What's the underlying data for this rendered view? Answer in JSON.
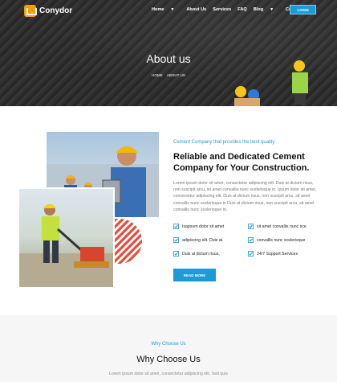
{
  "header": {
    "brand": "Conydor",
    "nav": [
      {
        "label": "Home",
        "has_dropdown": true
      },
      {
        "label": "About Us",
        "has_dropdown": false
      },
      {
        "label": "Services",
        "has_dropdown": false
      },
      {
        "label": "FAQ",
        "has_dropdown": false
      },
      {
        "label": "Blog",
        "has_dropdown": true
      },
      {
        "label": "Contact",
        "has_dropdown": false
      }
    ],
    "login_label": "LOGIN"
  },
  "hero": {
    "title": "About us",
    "breadcrumb": [
      "HOME",
      "ABOUT US"
    ]
  },
  "about": {
    "subtitle": "Cement Company that provides the best quality",
    "heading": "Reliable and Dedicated Cement Company for Your Construction.",
    "paragraph": "Lorem ipsum dolor sit amet, consectetur adipiscing elit. Duis at dictum risus, non suscipit arcu, sit amet convallis nunc scelerisque in. Ipsum dolor sit amet, consectetur adipiscing elit. Duis at dictum risus, non suscipit arcu, sit amet convallis nunc scelerisque in Duis at dictum risus, non suscipit arcu, sit amet convallis nunc scelerisque in.",
    "features": [
      "Isapsum dolor sit amet",
      "sit amet convallis nunc sce",
      "adipiscing elit. Duis at.",
      "convallis nunc scelerisque",
      "Duis at dictum risus,",
      "24/7 Support Services"
    ],
    "button_label": "READ MORE"
  },
  "why": {
    "subtitle": "Why Choose Us",
    "title": "Why Choose Us",
    "paragraph": "Lorem ipsum dolor sit amet, consectetur adipiscing elit. Sed quis"
  },
  "colors": {
    "accent": "#1e9bd7",
    "logo": "#f39c12",
    "stripe": "#e84c3d"
  }
}
